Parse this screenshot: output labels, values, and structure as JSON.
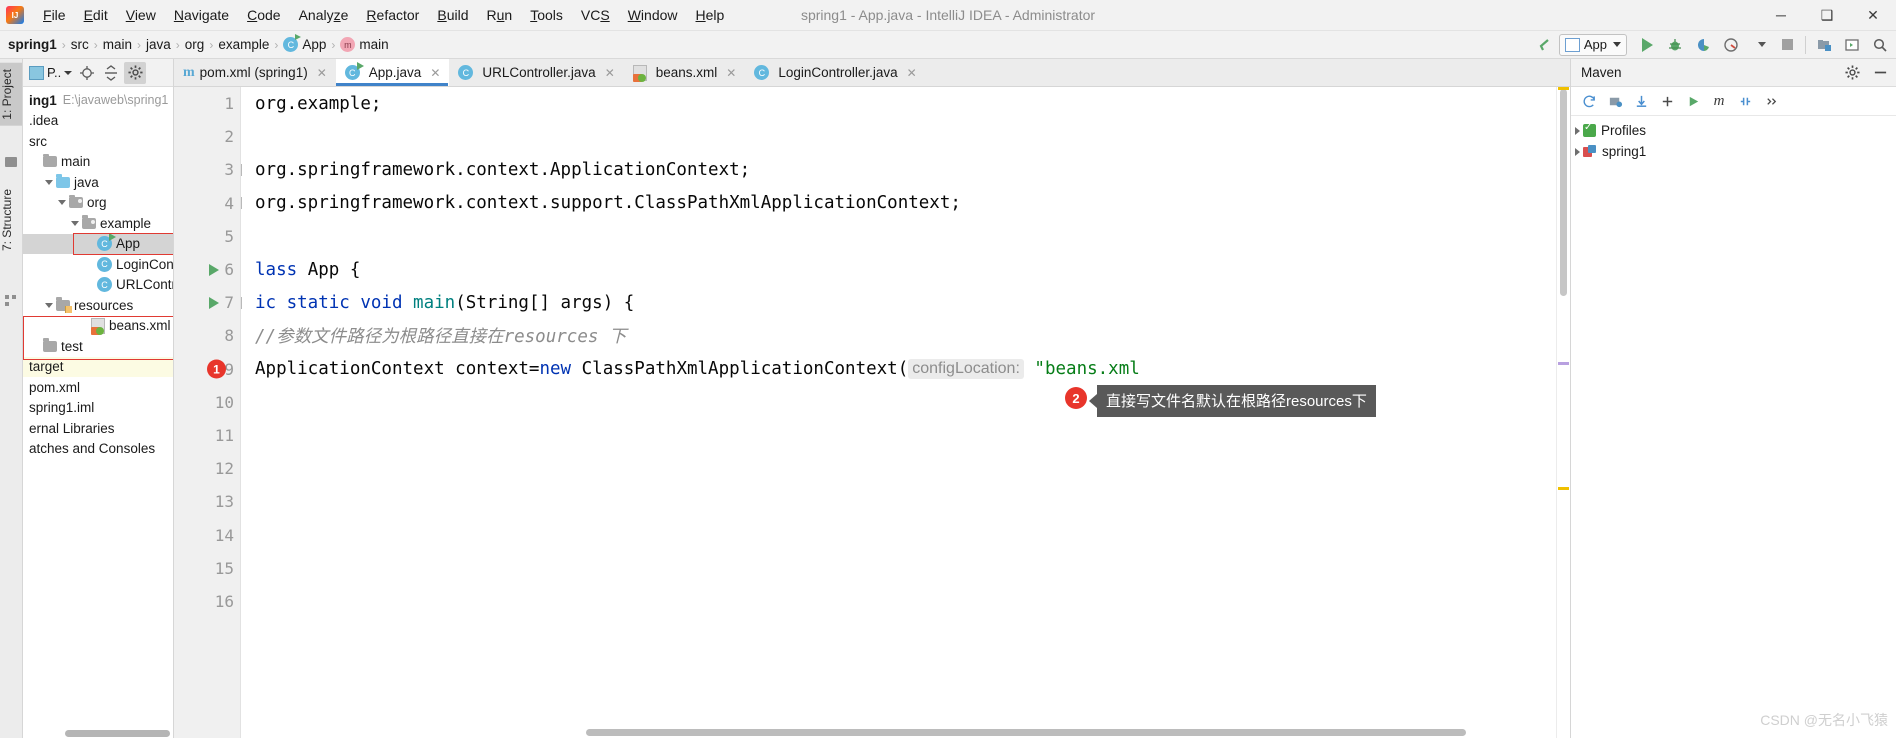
{
  "window": {
    "title": "spring1 - App.java - IntelliJ IDEA - Administrator",
    "logo_icon": "intellij-idea-logo",
    "minimize_icon": "minimize-icon",
    "maximize_icon": "maximize-icon",
    "close_icon": "close-icon",
    "minimize_glyph": "─",
    "maximize_glyph": "❑",
    "close_glyph": "✕"
  },
  "menubar": {
    "items": [
      "File",
      "Edit",
      "View",
      "Navigate",
      "Code",
      "Analyze",
      "Refactor",
      "Build",
      "Run",
      "Tools",
      "VCS",
      "Window",
      "Help"
    ]
  },
  "breadcrumb": {
    "items": [
      {
        "label": "spring1",
        "icon": null,
        "bold": true
      },
      {
        "label": "src",
        "icon": null,
        "bold": false
      },
      {
        "label": "main",
        "icon": null,
        "bold": false
      },
      {
        "label": "java",
        "icon": null,
        "bold": false
      },
      {
        "label": "org",
        "icon": null,
        "bold": false
      },
      {
        "label": "example",
        "icon": null,
        "bold": false
      },
      {
        "label": "App",
        "icon": "class-icon",
        "bold": false
      },
      {
        "label": "main",
        "icon": "method-icon",
        "bold": false
      }
    ],
    "separator": "›"
  },
  "toolbar": {
    "back_icon": "back-arrow-icon",
    "run_config_label": "App",
    "run_config_icon": "application-icon",
    "run_icon": "run-icon",
    "debug_icon": "debug-icon",
    "run_coverage_icon": "run-with-coverage-icon",
    "profile_icon": "profiler-icon",
    "stop_icon": "stop-icon",
    "build_icon": "build-project-icon",
    "open_terminal_icon": "terminal-icon",
    "search_icon": "search-everywhere-icon"
  },
  "left_strip": {
    "project_tab": "1: Project",
    "structure_tab": "7: Structure",
    "favorites_icon": "favorites-icon",
    "structure_icon": "structure-icon"
  },
  "project_panel": {
    "selector_label": "P..",
    "locate_icon": "locate-file-icon",
    "collapse_icon": "collapse-all-icon",
    "settings_icon": "gear-icon",
    "tree": [
      {
        "label": "ing1",
        "path": "E:\\javaweb\\spring1",
        "depth": 0,
        "icon": "project-icon",
        "arrow": "none",
        "bold": true,
        "state": "normal"
      },
      {
        "label": ".idea",
        "path": "",
        "depth": 0,
        "icon": "folder",
        "arrow": "none",
        "bold": false,
        "state": "normal"
      },
      {
        "label": "src",
        "path": "",
        "depth": 0,
        "icon": "folder",
        "arrow": "none",
        "bold": false,
        "state": "normal"
      },
      {
        "label": "main",
        "path": "",
        "depth": 1,
        "icon": "folder",
        "arrow": "none",
        "bold": false,
        "state": "normal"
      },
      {
        "label": "java",
        "path": "",
        "depth": 2,
        "icon": "folder-blue",
        "arrow": "down",
        "bold": false,
        "state": "normal"
      },
      {
        "label": "org",
        "path": "",
        "depth": 3,
        "icon": "folder-package",
        "arrow": "down",
        "bold": false,
        "state": "normal"
      },
      {
        "label": "example",
        "path": "",
        "depth": 4,
        "icon": "folder-package",
        "arrow": "down",
        "bold": false,
        "state": "normal"
      },
      {
        "label": "App",
        "path": "",
        "depth": 5,
        "icon": "class-runnable-icon",
        "arrow": "none",
        "bold": false,
        "state": "selected"
      },
      {
        "label": "LoginCon",
        "path": "",
        "depth": 5,
        "icon": "class-icon",
        "arrow": "none",
        "bold": false,
        "state": "normal"
      },
      {
        "label": "URLContr",
        "path": "",
        "depth": 5,
        "icon": "class-icon",
        "arrow": "none",
        "bold": false,
        "state": "normal"
      },
      {
        "label": "resources",
        "path": "",
        "depth": 2,
        "icon": "folder-resources",
        "arrow": "down",
        "bold": false,
        "state": "normal"
      },
      {
        "label": "beans.xml",
        "path": "",
        "depth": 3,
        "icon": "spring-xml-icon",
        "arrow": "none",
        "bold": false,
        "state": "normal"
      },
      {
        "label": "test",
        "path": "",
        "depth": 1,
        "icon": "folder",
        "arrow": "none",
        "bold": false,
        "state": "normal"
      },
      {
        "label": "target",
        "path": "",
        "depth": 0,
        "icon": "none",
        "arrow": "none",
        "bold": false,
        "state": "highlight"
      },
      {
        "label": "pom.xml",
        "path": "",
        "depth": 0,
        "icon": "none",
        "arrow": "none",
        "bold": false,
        "state": "normal"
      },
      {
        "label": "spring1.iml",
        "path": "",
        "depth": 0,
        "icon": "none",
        "arrow": "none",
        "bold": false,
        "state": "normal"
      },
      {
        "label": "ernal Libraries",
        "path": "",
        "depth": 0,
        "icon": "none",
        "arrow": "none",
        "bold": false,
        "state": "normal"
      },
      {
        "label": "atches and Consoles",
        "path": "",
        "depth": 0,
        "icon": "none",
        "arrow": "none",
        "bold": false,
        "state": "normal"
      }
    ]
  },
  "editor_tabs": [
    {
      "label": "pom.xml (spring1)",
      "icon": "maven-m-icon",
      "active": false,
      "close": "✕"
    },
    {
      "label": "App.java",
      "icon": "class-runnable-icon",
      "active": true,
      "close": "✕"
    },
    {
      "label": "URLController.java",
      "icon": "class-icon",
      "active": false,
      "close": "✕"
    },
    {
      "label": "beans.xml",
      "icon": "spring-xml-icon",
      "active": false,
      "close": "✕"
    },
    {
      "label": "LoginController.java",
      "icon": "class-icon",
      "active": false,
      "close": "✕"
    }
  ],
  "code": {
    "first_visible_line": 1,
    "lines": [
      {
        "n": 1,
        "segments": [
          {
            "t": "org.example;",
            "c": "plain"
          }
        ]
      },
      {
        "n": 2,
        "segments": []
      },
      {
        "n": 3,
        "segments": [
          {
            "t": "org.springframework.context.ApplicationContext;",
            "c": "plain"
          }
        ]
      },
      {
        "n": 4,
        "segments": [
          {
            "t": "org.springframework.context.support.ClassPathXmlApplicationContext;",
            "c": "plain"
          }
        ]
      },
      {
        "n": 5,
        "segments": []
      },
      {
        "n": 6,
        "segments": [
          {
            "t": "lass",
            "c": "kw"
          },
          {
            "t": " App {",
            "c": "plain"
          }
        ]
      },
      {
        "n": 7,
        "segments": [
          {
            "t": "ic static void ",
            "c": "kw"
          },
          {
            "t": "main",
            "c": "mname"
          },
          {
            "t": "(String[] args) {",
            "c": "plain"
          }
        ]
      },
      {
        "n": 8,
        "segments": [
          {
            "t": "//参数文件路径为根路径直接在resources 下",
            "c": "cmt"
          }
        ]
      },
      {
        "n": 9,
        "segments": [
          {
            "t": "ApplicationContext context=",
            "c": "plain"
          },
          {
            "t": "new",
            "c": "kw"
          },
          {
            "t": " ClassPathXmlApplicationContext(",
            "c": "plain"
          },
          {
            "t": "configLocation:",
            "c": "hint"
          },
          {
            "t": " \"beans.xml",
            "c": "str"
          }
        ]
      },
      {
        "n": 10,
        "segments": []
      },
      {
        "n": 11,
        "segments": []
      },
      {
        "n": 12,
        "segments": []
      },
      {
        "n": 13,
        "segments": []
      },
      {
        "n": 14,
        "segments": []
      },
      {
        "n": 15,
        "segments": []
      },
      {
        "n": 16,
        "segments": []
      }
    ],
    "gutter_marks": [
      {
        "line": 6,
        "type": "run-arrow"
      },
      {
        "line": 7,
        "type": "run-arrow"
      },
      {
        "line": 9,
        "type": "badge",
        "text": "1"
      }
    ]
  },
  "annotations": [
    {
      "id": "2",
      "text": "直接写文件名默认在根路径resources下"
    }
  ],
  "maven_panel": {
    "title": "Maven",
    "settings_icon": "gear-icon",
    "hide_icon": "hide-icon",
    "toolbar": {
      "reload_icon": "reload-all-maven-projects-icon",
      "generate_sources_icon": "generate-sources-icon",
      "download_icon": "download-sources-icon",
      "add_icon": "add-maven-project-icon",
      "run_icon": "run-maven-build-icon",
      "toggle_skip_tests_icon": "toggle-skip-tests-icon",
      "execute_goal_icon": "execute-maven-goal-icon",
      "more_icon": "more-options-icon"
    },
    "tree": [
      {
        "label": "Profiles",
        "icon": "profiles-icon",
        "arrow": "right"
      },
      {
        "label": "spring1",
        "icon": "maven-project-icon",
        "arrow": "right"
      }
    ]
  },
  "watermark": "CSDN @无名小飞猿",
  "colors": {
    "accent_blue": "#4083c9",
    "keyword_blue": "#0033b3",
    "string_green": "#067d17",
    "badge_red": "#e8352b",
    "annotation_box": "#e03a33",
    "tooltip_bg": "#595959",
    "run_green": "#59a869",
    "tree_selected": "#d4d4d4",
    "tree_highlight": "#fcfbe3"
  }
}
